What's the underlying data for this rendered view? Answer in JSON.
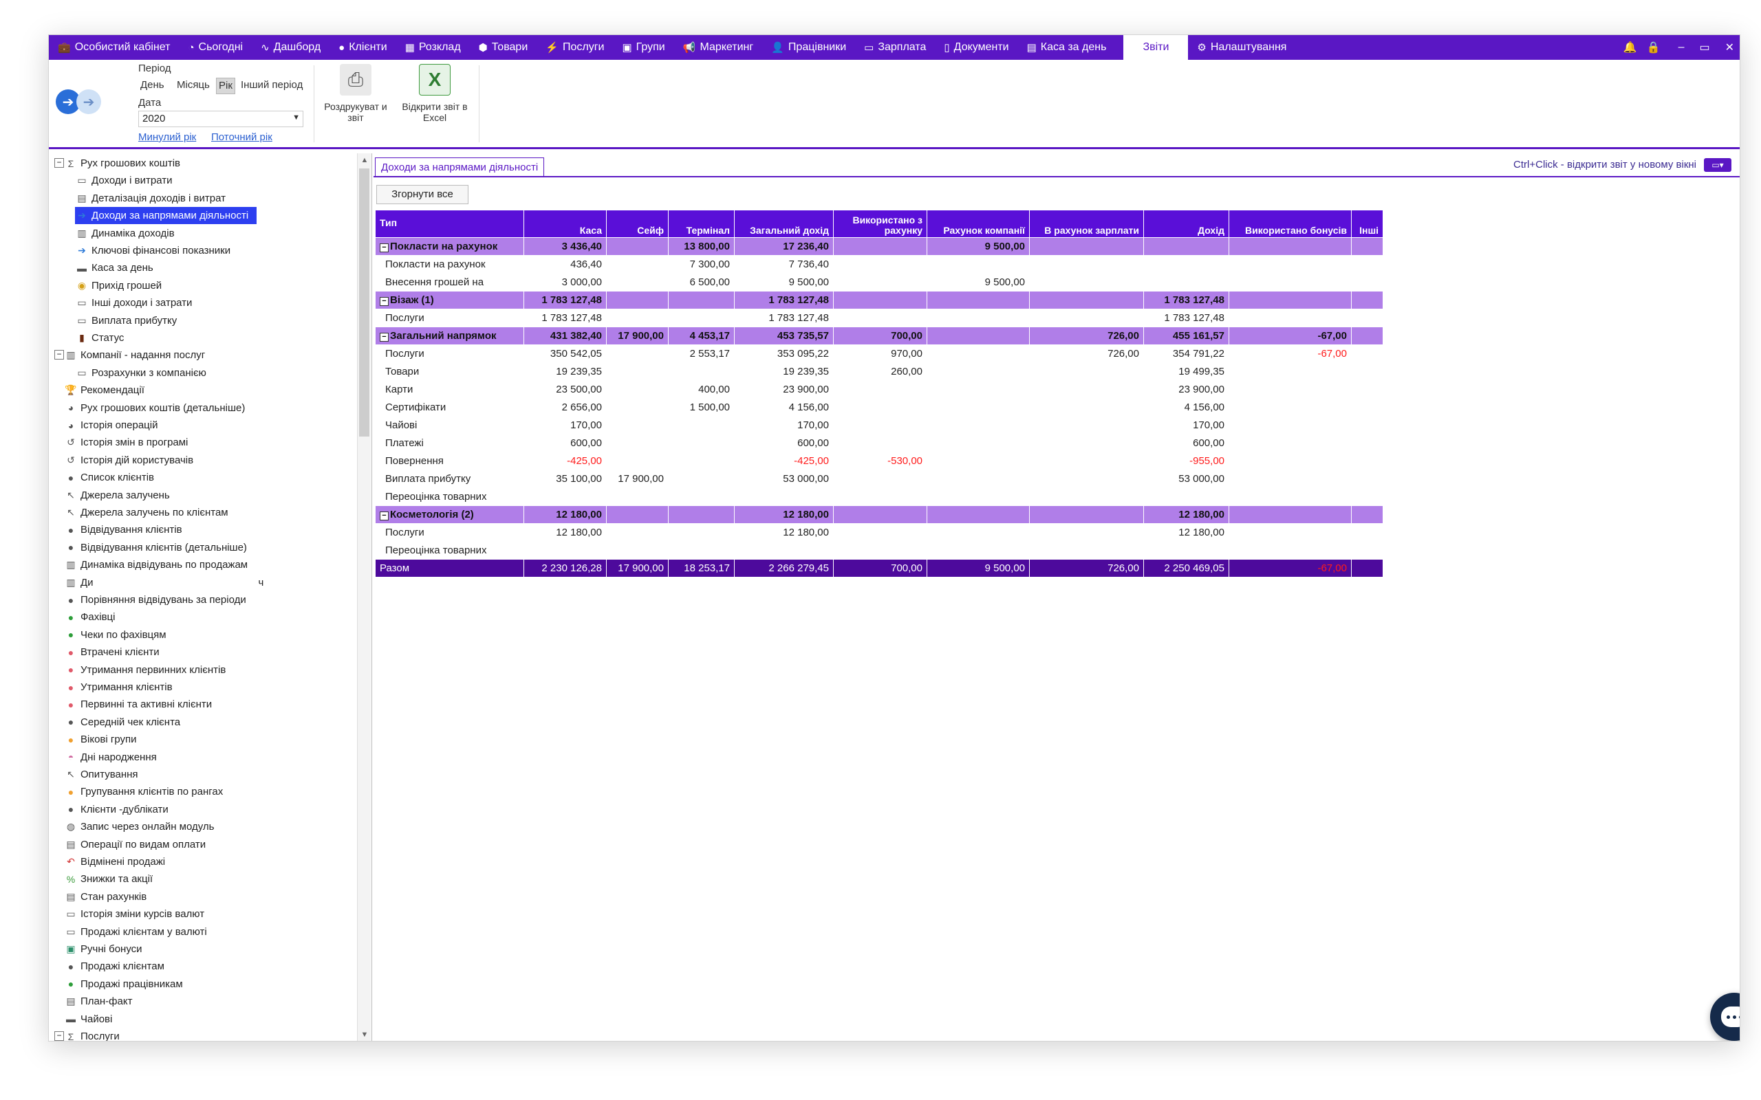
{
  "topnav": {
    "items": [
      {
        "label": "Особистий кабінет",
        "icon": "briefcase-icon",
        "glyph": "💼"
      },
      {
        "label": "Сьогодні",
        "icon": "clock-icon",
        "glyph": "◔"
      },
      {
        "label": "Дашборд",
        "icon": "pulse-icon",
        "glyph": "∿"
      },
      {
        "label": "Клієнти",
        "icon": "user-circle-icon",
        "glyph": "●"
      },
      {
        "label": "Розклад",
        "icon": "calendar-icon",
        "glyph": "▦"
      },
      {
        "label": "Товари",
        "icon": "box-icon",
        "glyph": "⬢"
      },
      {
        "label": "Послуги",
        "icon": "lightning-icon",
        "glyph": "⚡"
      },
      {
        "label": "Групи",
        "icon": "group-icon",
        "glyph": "▣"
      },
      {
        "label": "Маркетинг",
        "icon": "megaphone-icon",
        "glyph": "📢"
      },
      {
        "label": "Працівники",
        "icon": "person-icon",
        "glyph": "👤"
      },
      {
        "label": "Зарплата",
        "icon": "cash-icon",
        "glyph": "▭"
      },
      {
        "label": "Документи",
        "icon": "document-icon",
        "glyph": "▯"
      },
      {
        "label": "Каса за день",
        "icon": "calculator-icon",
        "glyph": "▤"
      }
    ],
    "active": "Звіти",
    "settings": "Налаштування",
    "settings_glyph": "⚙",
    "right_icons": {
      "bell": "🔔",
      "lock": "🔒",
      "minimize": "–",
      "restore": "▭",
      "close": "✕"
    }
  },
  "ribbon": {
    "period_label": "Період",
    "period_options": [
      "День",
      "Місяць",
      "Рік",
      "Інший період"
    ],
    "period_selected": "Рік",
    "date_label": "Дата",
    "date_value": "2020",
    "link_prev": "Минулий рік",
    "link_current": "Поточний рік",
    "print_label": "Роздрукуват и звіт",
    "excel_label": "Відкрити звіт в Excel"
  },
  "tree": [
    {
      "label": "Рух грошових коштів",
      "icon": "sigma-icon",
      "glyph": "Σ",
      "level": 0,
      "expander": "−"
    },
    {
      "label": "Доходи і витрати",
      "icon": "money-icon",
      "glyph": "▭",
      "level": 1
    },
    {
      "label": "Деталізація доходів і витрат",
      "icon": "calculator-icon",
      "glyph": "▤",
      "level": 1
    },
    {
      "label": "Доходи за напрямами діяльності",
      "icon": "arrow-right-icon",
      "glyph": "➔",
      "level": 1,
      "selected": true
    },
    {
      "label": "Динаміка доходів",
      "icon": "chart-icon",
      "glyph": "▥",
      "level": 1
    },
    {
      "label": "Ключові фінансові показники",
      "icon": "arrow-right-icon",
      "glyph": "➔",
      "level": 1
    },
    {
      "label": "Каса за день",
      "icon": "wallet-icon",
      "glyph": "▬",
      "level": 1
    },
    {
      "label": "Прихід грошей",
      "icon": "coins-icon",
      "glyph": "◉",
      "level": 1
    },
    {
      "label": "Інші доходи і затрати",
      "icon": "money-icon",
      "glyph": "▭",
      "level": 1
    },
    {
      "label": "Виплата прибутку",
      "icon": "money-icon",
      "glyph": "▭",
      "level": 1
    },
    {
      "label": "Статус",
      "icon": "status-icon",
      "glyph": "▮",
      "level": 1
    },
    {
      "label": "Компанії - надання послуг",
      "icon": "building-icon",
      "glyph": "▥",
      "level": 0,
      "expander": "−"
    },
    {
      "label": "Розрахунки з компанією",
      "icon": "money-icon",
      "glyph": "▭",
      "level": 1
    },
    {
      "label": "Рекомендації",
      "icon": "trophy-icon",
      "glyph": "🏆",
      "level": 0
    },
    {
      "label": "Рух грошових коштів (детальніше)",
      "icon": "pie-icon",
      "glyph": "◕",
      "level": 0
    },
    {
      "label": "Історія операцій",
      "icon": "pie-icon",
      "glyph": "◕",
      "level": 0
    },
    {
      "label": "Історія змін в програмі",
      "icon": "history-icon",
      "glyph": "↺",
      "level": 0
    },
    {
      "label": "Історія дій користувачів",
      "icon": "history-icon",
      "glyph": "↺",
      "level": 0
    },
    {
      "label": "Список клієнтів",
      "icon": "person-icon",
      "glyph": "●",
      "level": 0
    },
    {
      "label": "Джерела залучень",
      "icon": "cursor-icon",
      "glyph": "↖",
      "level": 0
    },
    {
      "label": "Джерела залучень по клієнтам",
      "icon": "cursor-icon",
      "glyph": "↖",
      "level": 0
    },
    {
      "label": "Відвідування клієнтів",
      "icon": "person-icon",
      "glyph": "●",
      "level": 0
    },
    {
      "label": "Відвідування клієнтів (детальніше)",
      "icon": "person-icon",
      "glyph": "●",
      "level": 0
    },
    {
      "label": "Динаміка відвідувань по продажам",
      "icon": "chart-icon",
      "glyph": "▥",
      "level": 0
    },
    {
      "label": "Ди",
      "suffix": "ч",
      "icon": "chart-icon",
      "glyph": "▥",
      "level": 0
    },
    {
      "label": "Порівняння відвідувань за періоди",
      "icon": "person-icon",
      "glyph": "●",
      "level": 0
    },
    {
      "label": "Фахівці",
      "icon": "person-green-icon",
      "glyph": "●",
      "level": 0
    },
    {
      "label": "Чеки по фахівцям",
      "icon": "person-green-icon",
      "glyph": "●",
      "level": 0
    },
    {
      "label": "Втрачені клієнти",
      "icon": "person-red-icon",
      "glyph": "●",
      "level": 0
    },
    {
      "label": "Утримання первинних клієнтів",
      "icon": "person-red-icon",
      "glyph": "●",
      "level": 0
    },
    {
      "label": "Утримання клієнтів",
      "icon": "person-red-icon",
      "glyph": "●",
      "level": 0
    },
    {
      "label": "Первинні та активні клієнти",
      "icon": "person-red-icon",
      "glyph": "●",
      "level": 0
    },
    {
      "label": "Середній чек клієнта",
      "icon": "person-icon",
      "glyph": "●",
      "level": 0
    },
    {
      "label": "Вікові групи",
      "icon": "person-orange-icon",
      "glyph": "●",
      "level": 0
    },
    {
      "label": "Дні народження",
      "icon": "cake-icon",
      "glyph": "◓",
      "level": 0
    },
    {
      "label": "Опитування",
      "icon": "cursor-icon",
      "glyph": "↖",
      "level": 0
    },
    {
      "label": "Групування клієнтів по рангах",
      "icon": "person-orange-icon",
      "glyph": "●",
      "level": 0
    },
    {
      "label": "Клієнти -дублікати",
      "icon": "people-icon",
      "glyph": "●",
      "level": 0
    },
    {
      "label": "Запис через онлайн модуль",
      "icon": "globe-icon",
      "glyph": "◍",
      "level": 0
    },
    {
      "label": "Операції по видам оплати",
      "icon": "calculator-icon",
      "glyph": "▤",
      "level": 0
    },
    {
      "label": "Відмінені продажі",
      "icon": "undo-icon",
      "glyph": "↶",
      "level": 0
    },
    {
      "label": "Знижки та акції",
      "icon": "percent-icon",
      "glyph": "%",
      "level": 0
    },
    {
      "label": "Стан рахунків",
      "icon": "calculator-icon",
      "glyph": "▤",
      "level": 0
    },
    {
      "label": "Історія зміни курсів валют",
      "icon": "money-icon",
      "glyph": "▭",
      "level": 0
    },
    {
      "label": "Продажі клієнтам у валюті",
      "icon": "money-icon",
      "glyph": "▭",
      "level": 0
    },
    {
      "label": "Ручні бонуси",
      "icon": "bonus-icon",
      "glyph": "▣",
      "level": 0
    },
    {
      "label": "Продажі клієнтам",
      "icon": "person-icon",
      "glyph": "●",
      "level": 0
    },
    {
      "label": "Продажі працівникам",
      "icon": "person-green-icon",
      "glyph": "●",
      "level": 0
    },
    {
      "label": "План-факт",
      "icon": "calculator-icon",
      "glyph": "▤",
      "level": 0
    },
    {
      "label": "Чайові",
      "icon": "tips-icon",
      "glyph": "▬",
      "level": 0
    },
    {
      "label": "Послуги",
      "icon": "sigma-icon",
      "glyph": "Σ",
      "level": 0,
      "expander": "−"
    }
  ],
  "report": {
    "tab_title": "Доходи за напрямами діяльності",
    "hint": "Ctrl+Click - відкрити звіт у новому вікні",
    "collapse_all": "Згорнути все",
    "columns": [
      "Тип",
      "Каса",
      "Сейф",
      "Термінал",
      "Загальний дохід",
      "Використано з рахунку",
      "Рахунок компанії",
      "В рахунок зарплати",
      "Дохід",
      "Використано бонусів",
      "Інші"
    ],
    "rows": [
      {
        "kind": "group",
        "cells": [
          "Покласти на рахунок",
          "3 436,40",
          "",
          "13 800,00",
          "17 236,40",
          "",
          "9 500,00",
          "",
          "",
          "",
          ""
        ]
      },
      {
        "kind": "item",
        "cells": [
          "Покласти на рахунок",
          "436,40",
          "",
          "7 300,00",
          "7 736,40",
          "",
          "",
          "",
          "",
          "",
          ""
        ]
      },
      {
        "kind": "item",
        "cells": [
          "Внесення грошей на",
          "3 000,00",
          "",
          "6 500,00",
          "9 500,00",
          "",
          "9 500,00",
          "",
          "",
          "",
          ""
        ]
      },
      {
        "kind": "group",
        "cells": [
          "Візаж (1)",
          "1 783 127,48",
          "",
          "",
          "1 783 127,48",
          "",
          "",
          "",
          "1 783 127,48",
          "",
          ""
        ]
      },
      {
        "kind": "item",
        "cells": [
          "Послуги",
          "1 783 127,48",
          "",
          "",
          "1 783 127,48",
          "",
          "",
          "",
          "1 783 127,48",
          "",
          ""
        ]
      },
      {
        "kind": "group",
        "cells": [
          "Загальний напрямок",
          "431 382,40",
          "17 900,00",
          "4 453,17",
          "453 735,57",
          "700,00",
          "",
          "726,00",
          "455 161,57",
          "-67,00",
          ""
        ]
      },
      {
        "kind": "item",
        "cells": [
          "Послуги",
          "350 542,05",
          "",
          "2 553,17",
          "353 095,22",
          "970,00",
          "",
          "726,00",
          "354 791,22",
          "-67,00",
          ""
        ]
      },
      {
        "kind": "item",
        "cells": [
          "Товари",
          "19 239,35",
          "",
          "",
          "19 239,35",
          "260,00",
          "",
          "",
          "19 499,35",
          "",
          ""
        ]
      },
      {
        "kind": "item",
        "cells": [
          "Карти",
          "23 500,00",
          "",
          "400,00",
          "23 900,00",
          "",
          "",
          "",
          "23 900,00",
          "",
          ""
        ]
      },
      {
        "kind": "item",
        "cells": [
          "Сертифікати",
          "2 656,00",
          "",
          "1 500,00",
          "4 156,00",
          "",
          "",
          "",
          "4 156,00",
          "",
          ""
        ]
      },
      {
        "kind": "item",
        "cells": [
          "Чайові",
          "170,00",
          "",
          "",
          "170,00",
          "",
          "",
          "",
          "170,00",
          "",
          ""
        ]
      },
      {
        "kind": "item",
        "cells": [
          "Платежі",
          "600,00",
          "",
          "",
          "600,00",
          "",
          "",
          "",
          "600,00",
          "",
          ""
        ]
      },
      {
        "kind": "item",
        "cells": [
          "Повернення",
          "-425,00",
          "",
          "",
          "-425,00",
          "-530,00",
          "",
          "",
          "-955,00",
          "",
          ""
        ]
      },
      {
        "kind": "item",
        "cells": [
          "Виплата прибутку",
          "35 100,00",
          "17 900,00",
          "",
          "53 000,00",
          "",
          "",
          "",
          "53 000,00",
          "",
          ""
        ]
      },
      {
        "kind": "item",
        "cells": [
          "Переоцінка товарних",
          "",
          "",
          "",
          "",
          "",
          "",
          "",
          "",
          "",
          ""
        ]
      },
      {
        "kind": "group",
        "cells": [
          "Косметологія (2)",
          "12 180,00",
          "",
          "",
          "12 180,00",
          "",
          "",
          "",
          "12 180,00",
          "",
          ""
        ]
      },
      {
        "kind": "item",
        "cells": [
          "Послуги",
          "12 180,00",
          "",
          "",
          "12 180,00",
          "",
          "",
          "",
          "12 180,00",
          "",
          ""
        ]
      },
      {
        "kind": "item",
        "cells": [
          "Переоцінка товарних",
          "",
          "",
          "",
          "",
          "",
          "",
          "",
          "",
          "",
          ""
        ]
      },
      {
        "kind": "total",
        "cells": [
          "Разом",
          "2 230 126,28",
          "17 900,00",
          "18 253,17",
          "2 266 279,45",
          "700,00",
          "9 500,00",
          "726,00",
          "2 250 469,05",
          "-67,00",
          ""
        ]
      }
    ]
  },
  "colors": {
    "accent": "#5a17c4",
    "group_row": "#b07ee8",
    "total_row": "#4d0a9c",
    "negative": "#ff1a1a",
    "selected": "#2d3ff0",
    "chat": "#152a4a"
  }
}
